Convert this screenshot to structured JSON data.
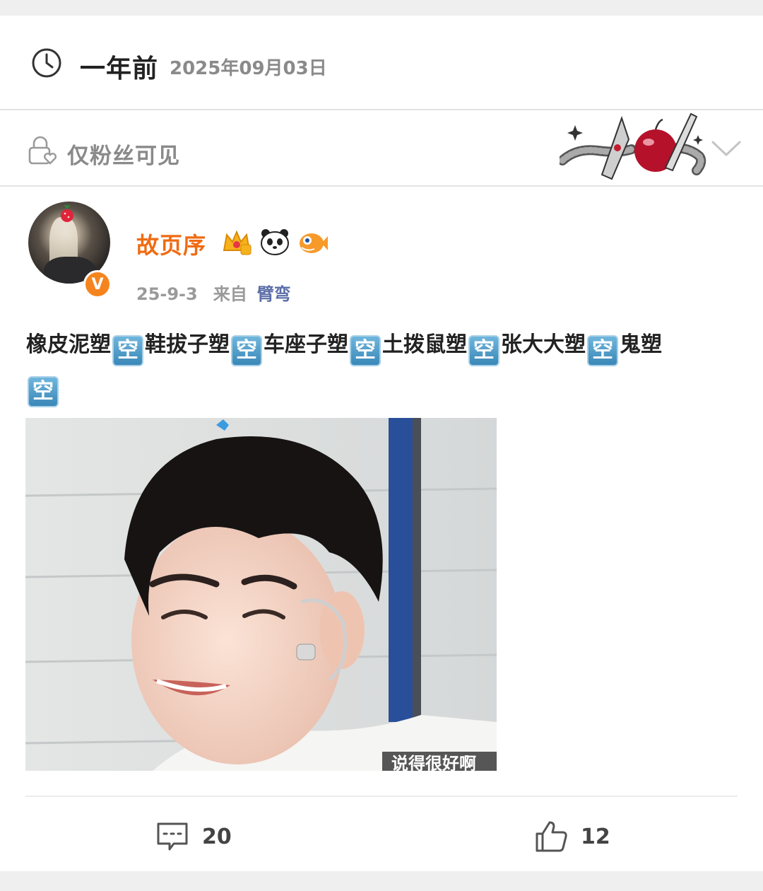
{
  "header": {
    "relative_time": "一年前",
    "absolute_date": "2025年09月03日"
  },
  "visibility": {
    "label": "仅粉丝可见"
  },
  "post": {
    "user": {
      "name": "故页序",
      "verified_mark": "V"
    },
    "date": "25-9-3",
    "from_label": "来自",
    "source": "臂弯",
    "text_segments": [
      "橡皮泥塑",
      "鞋拔子塑",
      "车座子塑",
      "土拨鼠塑",
      "张大大塑",
      "鬼塑",
      ""
    ],
    "emoji_char": "空",
    "photo_caption_fragment": "说得很好啊",
    "comment_count": "20",
    "like_count": "12"
  },
  "icons": {
    "clock": "clock-icon",
    "lock": "lock-heart-icon",
    "chevron": "chevron-down-icon",
    "comment": "comment-icon",
    "like": "thumbs-up-icon"
  },
  "colors": {
    "username": "#f06b12",
    "source": "#5b6ea8",
    "verified": "#f5841f"
  }
}
